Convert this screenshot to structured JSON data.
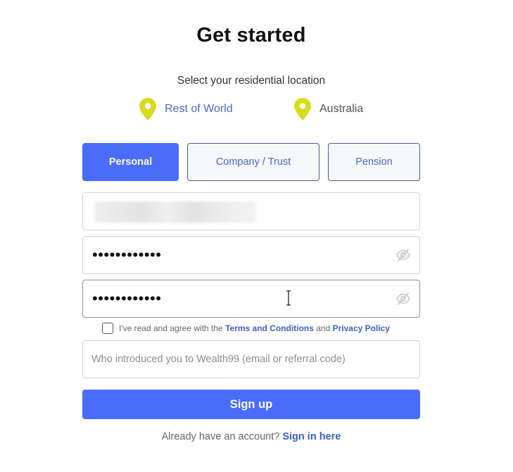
{
  "title": "Get started",
  "location": {
    "prompt": "Select your residential location",
    "options": [
      {
        "label": "Rest of World",
        "selected": true
      },
      {
        "label": "Australia",
        "selected": false
      }
    ],
    "pin_color": "#d9dc1e"
  },
  "account_types": [
    {
      "label": "Personal",
      "active": true
    },
    {
      "label": "Company / Trust",
      "active": false
    },
    {
      "label": "Pension",
      "active": false
    }
  ],
  "form": {
    "password_value": "••••••••••••",
    "confirm_password_value": "••••••••••••",
    "terms": {
      "prefix": "I've read and agree with the",
      "terms_link": "Terms and Conditions",
      "conjunction": "and",
      "privacy_link": "Privacy Policy",
      "checked": false
    },
    "referral_placeholder": "Who introduced you to Wealth99 (email or referral code)",
    "submit_label": "Sign up"
  },
  "footer": {
    "prompt": "Already have an account?",
    "link": "Sign in here"
  },
  "colors": {
    "primary": "#4a6cfa",
    "link": "#3f5fc4"
  }
}
